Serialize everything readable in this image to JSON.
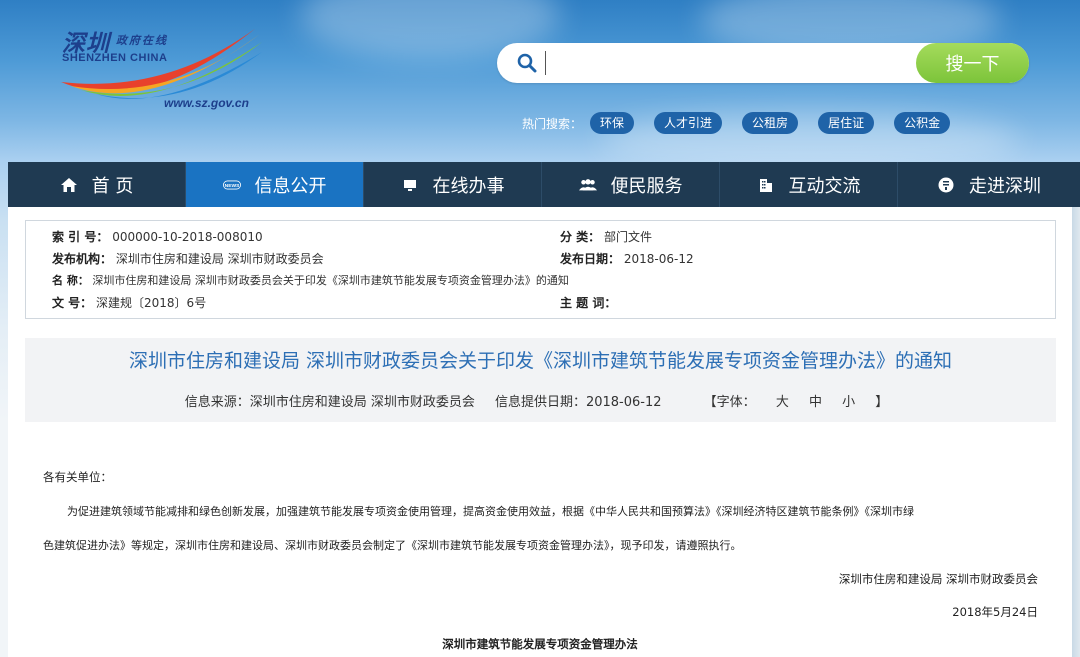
{
  "header": {
    "logo": {
      "name_cn": "深圳",
      "subtitle_cn": "政府在线",
      "name_en": "SHENZHEN CHINA",
      "url": "www.sz.gov.cn"
    },
    "search": {
      "placeholder": "",
      "button_label": "搜一下"
    },
    "hot_search": {
      "label": "热门搜索：",
      "tags": [
        "环保",
        "人才引进",
        "公租房",
        "居住证",
        "公积金"
      ]
    }
  },
  "nav": {
    "items": [
      {
        "label": "首 页",
        "icon": "home-icon"
      },
      {
        "label": "信息公开",
        "icon": "news-icon"
      },
      {
        "label": "在线办事",
        "icon": "monitor-icon"
      },
      {
        "label": "便民服务",
        "icon": "people-icon"
      },
      {
        "label": "互动交流",
        "icon": "building-icon"
      },
      {
        "label": "走进深圳",
        "icon": "info-icon"
      }
    ],
    "active_index": 1
  },
  "meta": {
    "index_no": {
      "key": "索 引 号：",
      "value": "000000-10-2018-008010"
    },
    "category": {
      "key": "分  类：",
      "value": "部门文件"
    },
    "publisher": {
      "key": "发布机构：",
      "value": "深圳市住房和建设局 深圳市财政委员会"
    },
    "publish_date": {
      "key": "发布日期：",
      "value": "2018-06-12"
    },
    "name": {
      "key": "名  称：",
      "value": "深圳市住房和建设局 深圳市财政委员会关于印发《深圳市建筑节能发展专项资金管理办法》的通知"
    },
    "doc_no": {
      "key": "文 号：",
      "value": "深建规〔2018〕6号"
    },
    "keywords": {
      "key": "主 题 词：",
      "value": ""
    }
  },
  "article": {
    "title": "深圳市住房和建设局 深圳市财政委员会关于印发《深圳市建筑节能发展专项资金管理办法》的通知",
    "source": "信息来源：深圳市住房和建设局 深圳市财政委员会",
    "provide_date": "信息提供日期：2018-06-12",
    "font_size_label_open": "【字体：",
    "font_sizes": [
      "大",
      "中",
      "小"
    ],
    "font_size_label_close": "】",
    "salutation": "各有关单位：",
    "body_line_1": "为促进建筑领域节能减排和绿色创新发展，加强建筑节能发展专项资金使用管理，提高资金使用效益，根据《中华人民共和国预算法》《深圳经济特区建筑节能条例》《深圳市绿",
    "body_line_2": "色建筑促进办法》等规定，深圳市住房和建设局、深圳市财政委员会制定了《深圳市建筑节能发展专项资金管理办法》，现予印发，请遵照执行。",
    "signature": "深圳市住房和建设局  深圳市财政委员会",
    "sign_date": "2018年5月24日",
    "attachment_title": "深圳市建筑节能发展专项资金管理办法"
  },
  "colors": {
    "nav_bg": "#1f3a52",
    "nav_active": "#1a73c2",
    "title_blue": "#2d6fb5",
    "search_btn": "#7cc43a",
    "hot_tag": "#1f63a8"
  }
}
